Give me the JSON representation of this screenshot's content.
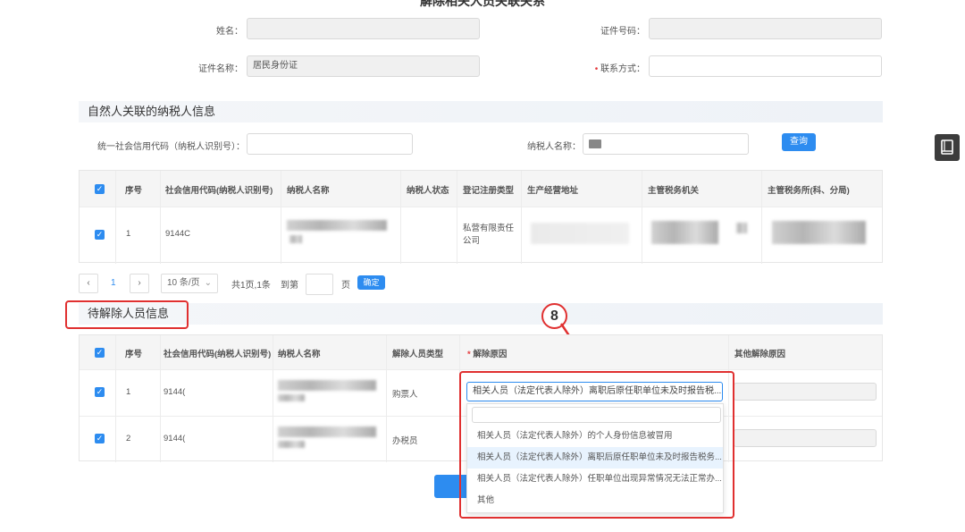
{
  "page": {
    "title": "解除相关人员关联关系"
  },
  "form": {
    "name_label": "姓名：",
    "name_value": "",
    "id_no_label": "证件号码：",
    "id_no_value": "",
    "id_type_label": "证件名称：",
    "id_type_value": "居民身份证",
    "contact_label": "联系方式：",
    "contact_value": ""
  },
  "section1": {
    "title": "自然人关联的纳税人信息",
    "credit_code_label": "统一社会信用代码（纳税人识别号）：",
    "taxpayer_name_label": "纳税人名称：",
    "query_button": "查询"
  },
  "table1": {
    "headers": [
      "序号",
      "社会信用代码(纳税人识别号)",
      "纳税人名称",
      "纳税人状态",
      "登记注册类型",
      "生产经营地址",
      "主管税务机关",
      "主管税务所(科、分局)"
    ],
    "rows": [
      {
        "index": "1",
        "code": "9144C",
        "reg_type": "私营有限责任公司"
      }
    ]
  },
  "pagination": {
    "prev": "‹",
    "page": "1",
    "next": "›",
    "page_size": "10 条/页",
    "summary": "共1页,1条",
    "goto_label": "到第",
    "page_unit": "页",
    "confirm": "确定"
  },
  "section2": {
    "title": "待解除人员信息"
  },
  "table2": {
    "headers": [
      "序号",
      "社会信用代码(纳税人识别号)",
      "纳税人名称",
      "解除人员类型",
      "解除原因",
      "其他解除原因"
    ],
    "rows": [
      {
        "index": "1",
        "code": "9144(",
        "type": "购票人"
      },
      {
        "index": "2",
        "code": "9144(",
        "type": "办税员"
      }
    ]
  },
  "reason_select": {
    "selected": "相关人员（法定代表人除外）离职后原任职单位未及时报告税...",
    "options": [
      "相关人员（法定代表人除外）的个人身份信息被冒用",
      "相关人员（法定代表人除外）离职后原任职单位未及时报告税务...",
      "相关人员（法定代表人除外）任职单位出现异常情况无法正常办...",
      "其他"
    ]
  },
  "annotation": {
    "step": "8"
  },
  "colors": {
    "accent": "#2d8cf0",
    "highlight": "#e03030"
  }
}
